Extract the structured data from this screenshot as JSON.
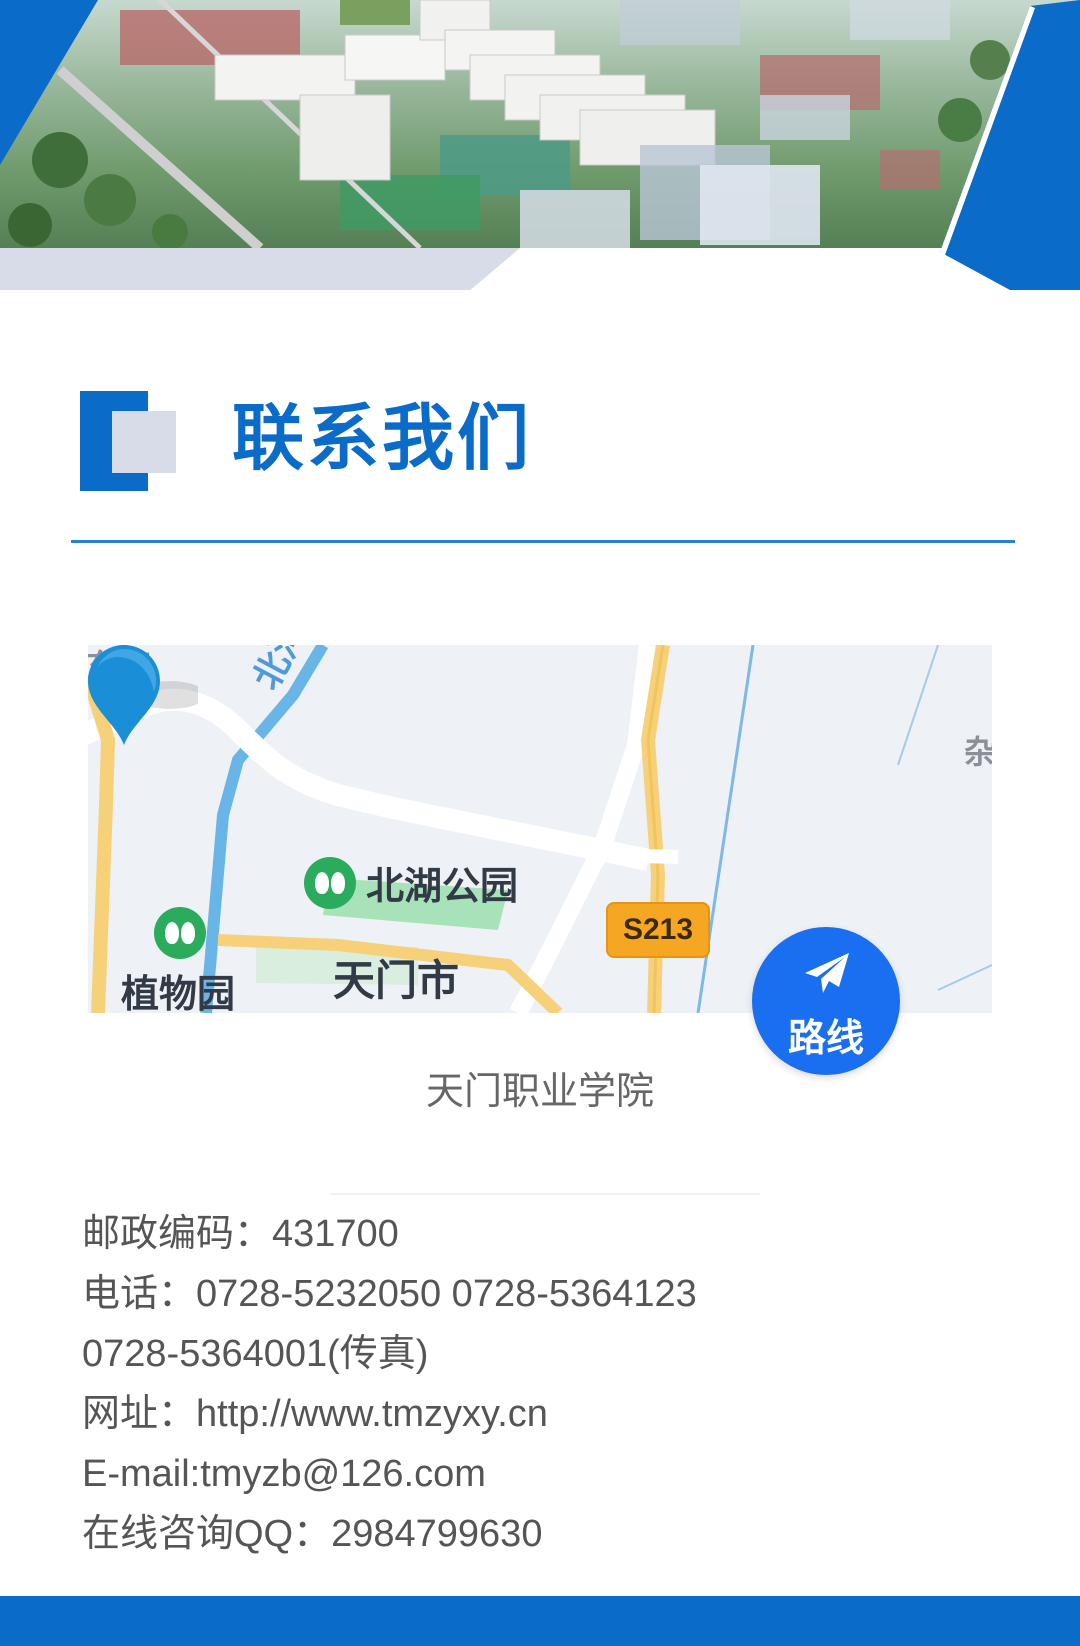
{
  "section": {
    "title": "联系我们"
  },
  "map": {
    "labels": {
      "poi_park": "北湖公园",
      "poi_garden": "植物园",
      "city": "天门市",
      "road_shield": "S213",
      "edge_top_left": "东湾",
      "edge_right": "杂",
      "river": "北河"
    },
    "route_button": {
      "label": "路线",
      "icon": "paper-plane-icon"
    },
    "place_name": "天门职业学院"
  },
  "contact": {
    "postcode": "邮政编码：431700",
    "phone_line1": "电话：0728-5232050 0728-5364123",
    "phone_line2": "0728-5364001(传真)",
    "website": "网址：http://www.tmzyxy.cn",
    "email": "E-mail:tmyzb@126.com",
    "qq": "在线咨询QQ：2984799630"
  },
  "colors": {
    "accent": "#0a6cc8",
    "route_button": "#1a6ff0",
    "park_icon": "#2bab5c",
    "road_shield": "#f5a623"
  }
}
